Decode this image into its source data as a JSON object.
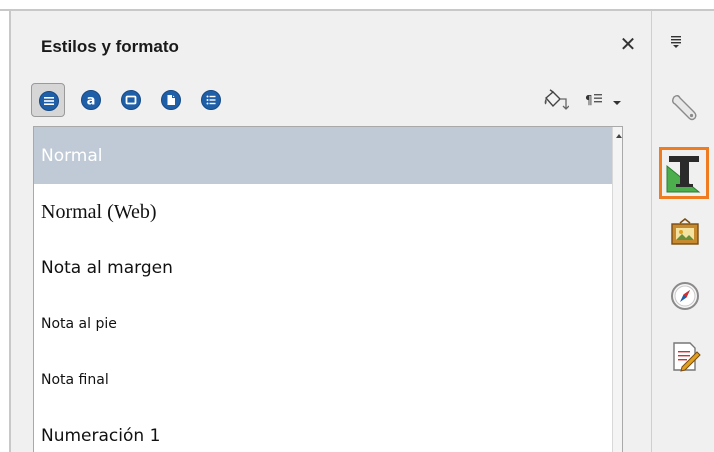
{
  "panel": {
    "title": "Estilos y formato",
    "close_glyph": "✕"
  },
  "toolbar": {
    "families": [
      {
        "name": "paragraph-styles-icon",
        "active": true
      },
      {
        "name": "character-styles-icon",
        "active": false
      },
      {
        "name": "frame-styles-icon",
        "active": false
      },
      {
        "name": "page-styles-icon",
        "active": false
      },
      {
        "name": "list-styles-icon",
        "active": false
      }
    ],
    "fill_format_icon": "fill-format-mode-icon",
    "new_style_icon": "new-style-from-selection-icon",
    "dropdown_icon": "chevron-down-icon"
  },
  "styles": [
    {
      "label": "Normal",
      "selected": true
    },
    {
      "label": "Normal (Web)",
      "selected": false
    },
    {
      "label": "Nota al margen",
      "selected": false
    },
    {
      "label": "Nota al pie",
      "selected": false
    },
    {
      "label": "Nota final",
      "selected": false
    },
    {
      "label": "Numeración 1",
      "selected": false
    }
  ],
  "sidebar": {
    "menu_icon": "sidebar-menu-icon",
    "tabs": [
      {
        "name": "properties-wrench-icon",
        "highlighted": false
      },
      {
        "name": "styles-and-formatting-icon",
        "highlighted": true
      },
      {
        "name": "gallery-icon",
        "highlighted": false
      },
      {
        "name": "navigator-compass-icon",
        "highlighted": false
      },
      {
        "name": "manage-changes-icon",
        "highlighted": false
      }
    ]
  },
  "colors": {
    "highlight_border": "#f07c22",
    "selected_row": "#bfcad6",
    "icon_blue": "#1f5fa8"
  }
}
